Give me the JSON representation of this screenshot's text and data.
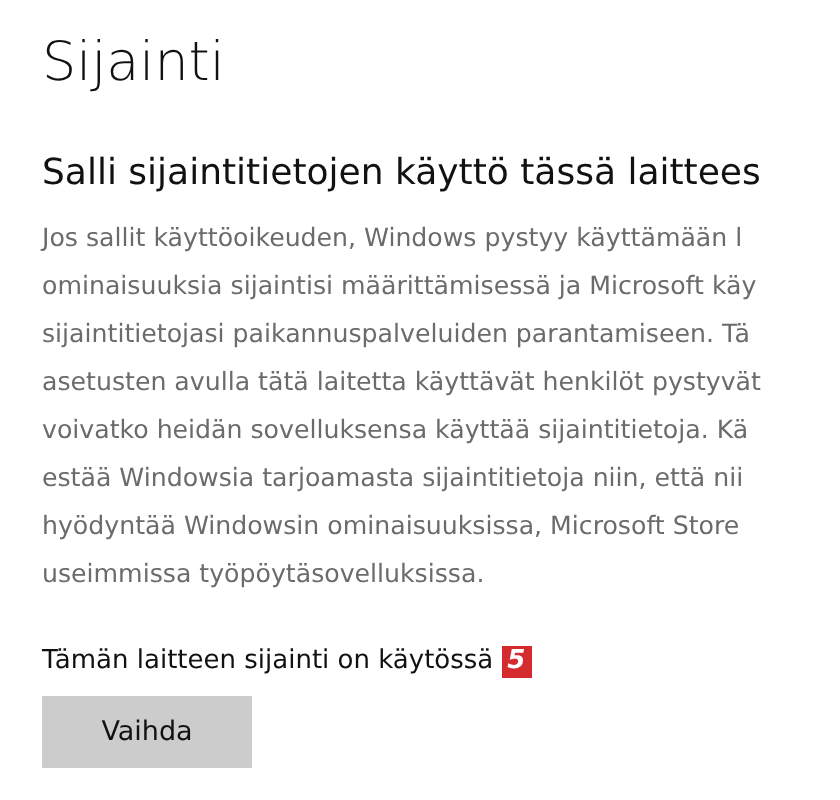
{
  "page_title": "Sijainti",
  "section": {
    "heading": "Salli sijaintitietojen käyttö tässä laittees",
    "description_lines": [
      "Jos sallit käyttöoikeuden, Windows pystyy käyttämään l",
      "ominaisuuksia sijaintisi määrittämisessä ja Microsoft käy",
      "sijaintitietojasi paikannuspalveluiden parantamiseen. Tä",
      "asetusten avulla tätä laitetta käyttävät henkilöt pystyvät",
      "voivatko heidän sovelluksensa käyttää sijaintitietoja. Kä",
      "estää Windowsia tarjoamasta sijaintitietoja niin, että nii",
      "hyödyntää Windowsin ominaisuuksissa, Microsoft Store",
      "useimmissa työpöytäsovelluksissa."
    ],
    "status": "Tämän laitteen sijainti on käytössä",
    "marker": "5",
    "button": "Vaihda"
  }
}
